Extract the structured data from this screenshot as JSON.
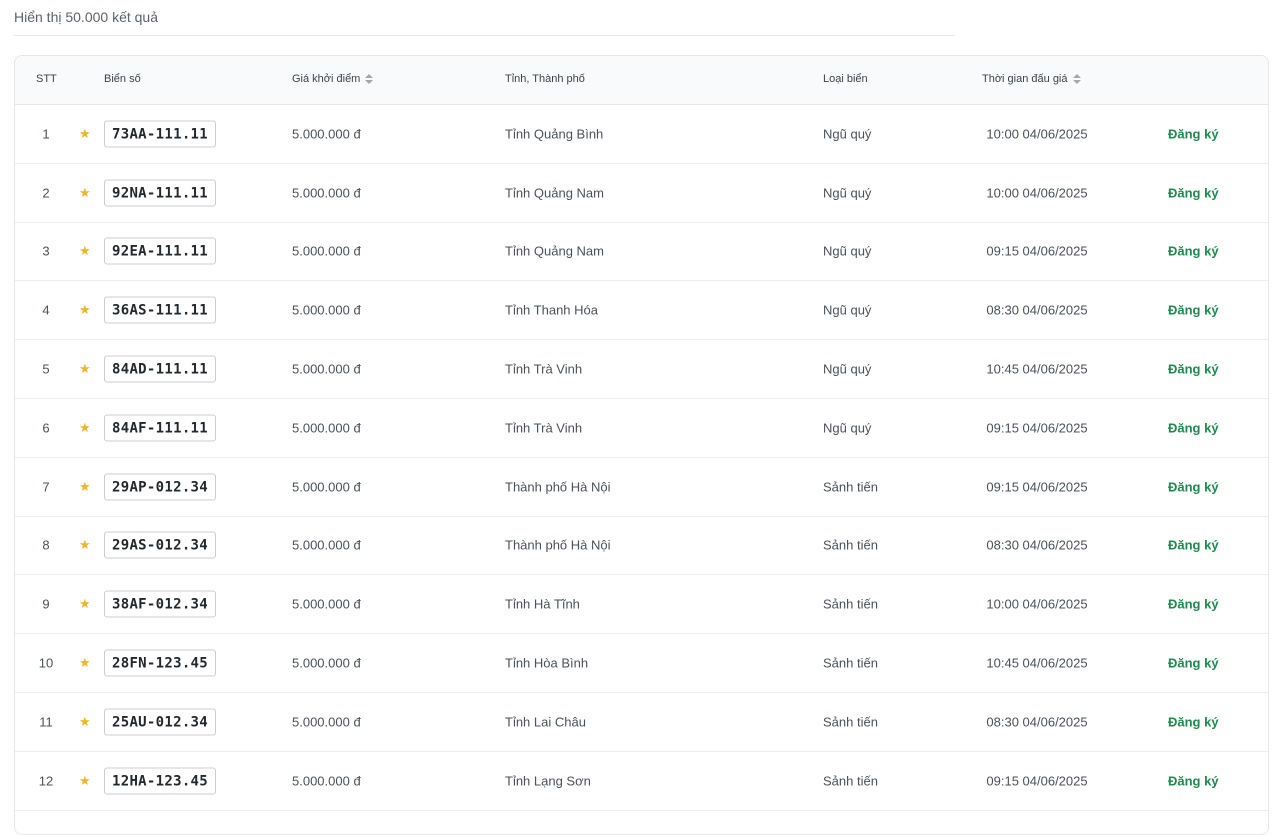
{
  "results": {
    "text": "Hiển thị 50.000 kết quả"
  },
  "table": {
    "headers": {
      "stt": "STT",
      "plate": "Biển số",
      "price": "Giá khởi điểm",
      "province": "Tỉnh, Thành phố",
      "type": "Loại biển",
      "time": "Thời gian đấu giá"
    },
    "star_icon": "star-icon",
    "register_label": "Đăng ký",
    "rows": [
      {
        "stt": "1",
        "plate": "73AA-111.11",
        "price": "5.000.000 đ",
        "province": "Tỉnh Quảng Bình",
        "type": "Ngũ quý",
        "time": "10:00 04/06/2025"
      },
      {
        "stt": "2",
        "plate": "92NA-111.11",
        "price": "5.000.000 đ",
        "province": "Tỉnh Quảng Nam",
        "type": "Ngũ quý",
        "time": "10:00 04/06/2025"
      },
      {
        "stt": "3",
        "plate": "92EA-111.11",
        "price": "5.000.000 đ",
        "province": "Tỉnh Quảng Nam",
        "type": "Ngũ quý",
        "time": "09:15 04/06/2025"
      },
      {
        "stt": "4",
        "plate": "36AS-111.11",
        "price": "5.000.000 đ",
        "province": "Tỉnh Thanh Hóa",
        "type": "Ngũ quý",
        "time": "08:30 04/06/2025"
      },
      {
        "stt": "5",
        "plate": "84AD-111.11",
        "price": "5.000.000 đ",
        "province": "Tỉnh Trà Vinh",
        "type": "Ngũ quý",
        "time": "10:45 04/06/2025"
      },
      {
        "stt": "6",
        "plate": "84AF-111.11",
        "price": "5.000.000 đ",
        "province": "Tỉnh Trà Vinh",
        "type": "Ngũ quý",
        "time": "09:15 04/06/2025"
      },
      {
        "stt": "7",
        "plate": "29AP-012.34",
        "price": "5.000.000 đ",
        "province": "Thành phố Hà Nội",
        "type": "Sảnh tiến",
        "time": "09:15 04/06/2025"
      },
      {
        "stt": "8",
        "plate": "29AS-012.34",
        "price": "5.000.000 đ",
        "province": "Thành phố Hà Nội",
        "type": "Sảnh tiến",
        "time": "08:30 04/06/2025"
      },
      {
        "stt": "9",
        "plate": "38AF-012.34",
        "price": "5.000.000 đ",
        "province": "Tỉnh Hà Tĩnh",
        "type": "Sảnh tiến",
        "time": "10:00 04/06/2025"
      },
      {
        "stt": "10",
        "plate": "28FN-123.45",
        "price": "5.000.000 đ",
        "province": "Tỉnh Hòa Bình",
        "type": "Sảnh tiến",
        "time": "10:45 04/06/2025"
      },
      {
        "stt": "11",
        "plate": "25AU-012.34",
        "price": "5.000.000 đ",
        "province": "Tỉnh Lai Châu",
        "type": "Sảnh tiến",
        "time": "08:30 04/06/2025"
      },
      {
        "stt": "12",
        "plate": "12HA-123.45",
        "price": "5.000.000 đ",
        "province": "Tỉnh Lạng Sơn",
        "type": "Sảnh tiến",
        "time": "09:15 04/06/2025"
      }
    ]
  }
}
